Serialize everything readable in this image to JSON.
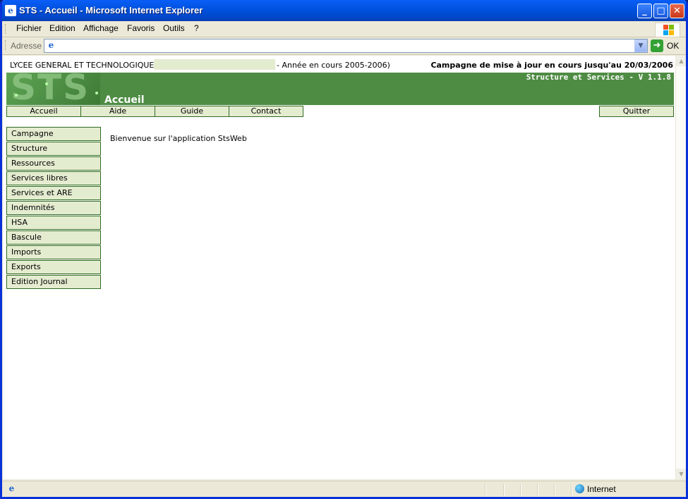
{
  "window": {
    "title": "STS - Accueil - Microsoft Internet Explorer"
  },
  "menu": [
    "Fichier",
    "Edition",
    "Affichage",
    "Favoris",
    "Outils",
    "?"
  ],
  "address": {
    "label": "Adresse",
    "value": "",
    "go_label": "OK"
  },
  "page": {
    "school": "LYCEE GENERAL ET TECHNOLOGIQUE",
    "school_name": "",
    "year": "- Année en cours 2005-2006)",
    "campaign": "Campagne de mise à jour en cours jusqu'au 20/03/2006",
    "version": "Structure et Services - V 1.1.8",
    "logo_text": "STS",
    "section_title": "Accueil",
    "topnav": [
      "Accueil",
      "Aide",
      "Guide",
      "Contact"
    ],
    "quit": "Quitter",
    "sidebar": [
      "Campagne",
      "Structure",
      "Ressources",
      "Services libres",
      "Services et ARE",
      "Indemnités",
      "HSA",
      "Bascule",
      "Imports",
      "Exports",
      "Edition Journal"
    ],
    "welcome": "Bienvenue sur l'application StsWeb"
  },
  "status": {
    "zone": "Internet"
  },
  "colors": {
    "header_green": "#4e8c43",
    "button_fill": "#e4ecd0",
    "button_border": "#2f6b22"
  }
}
